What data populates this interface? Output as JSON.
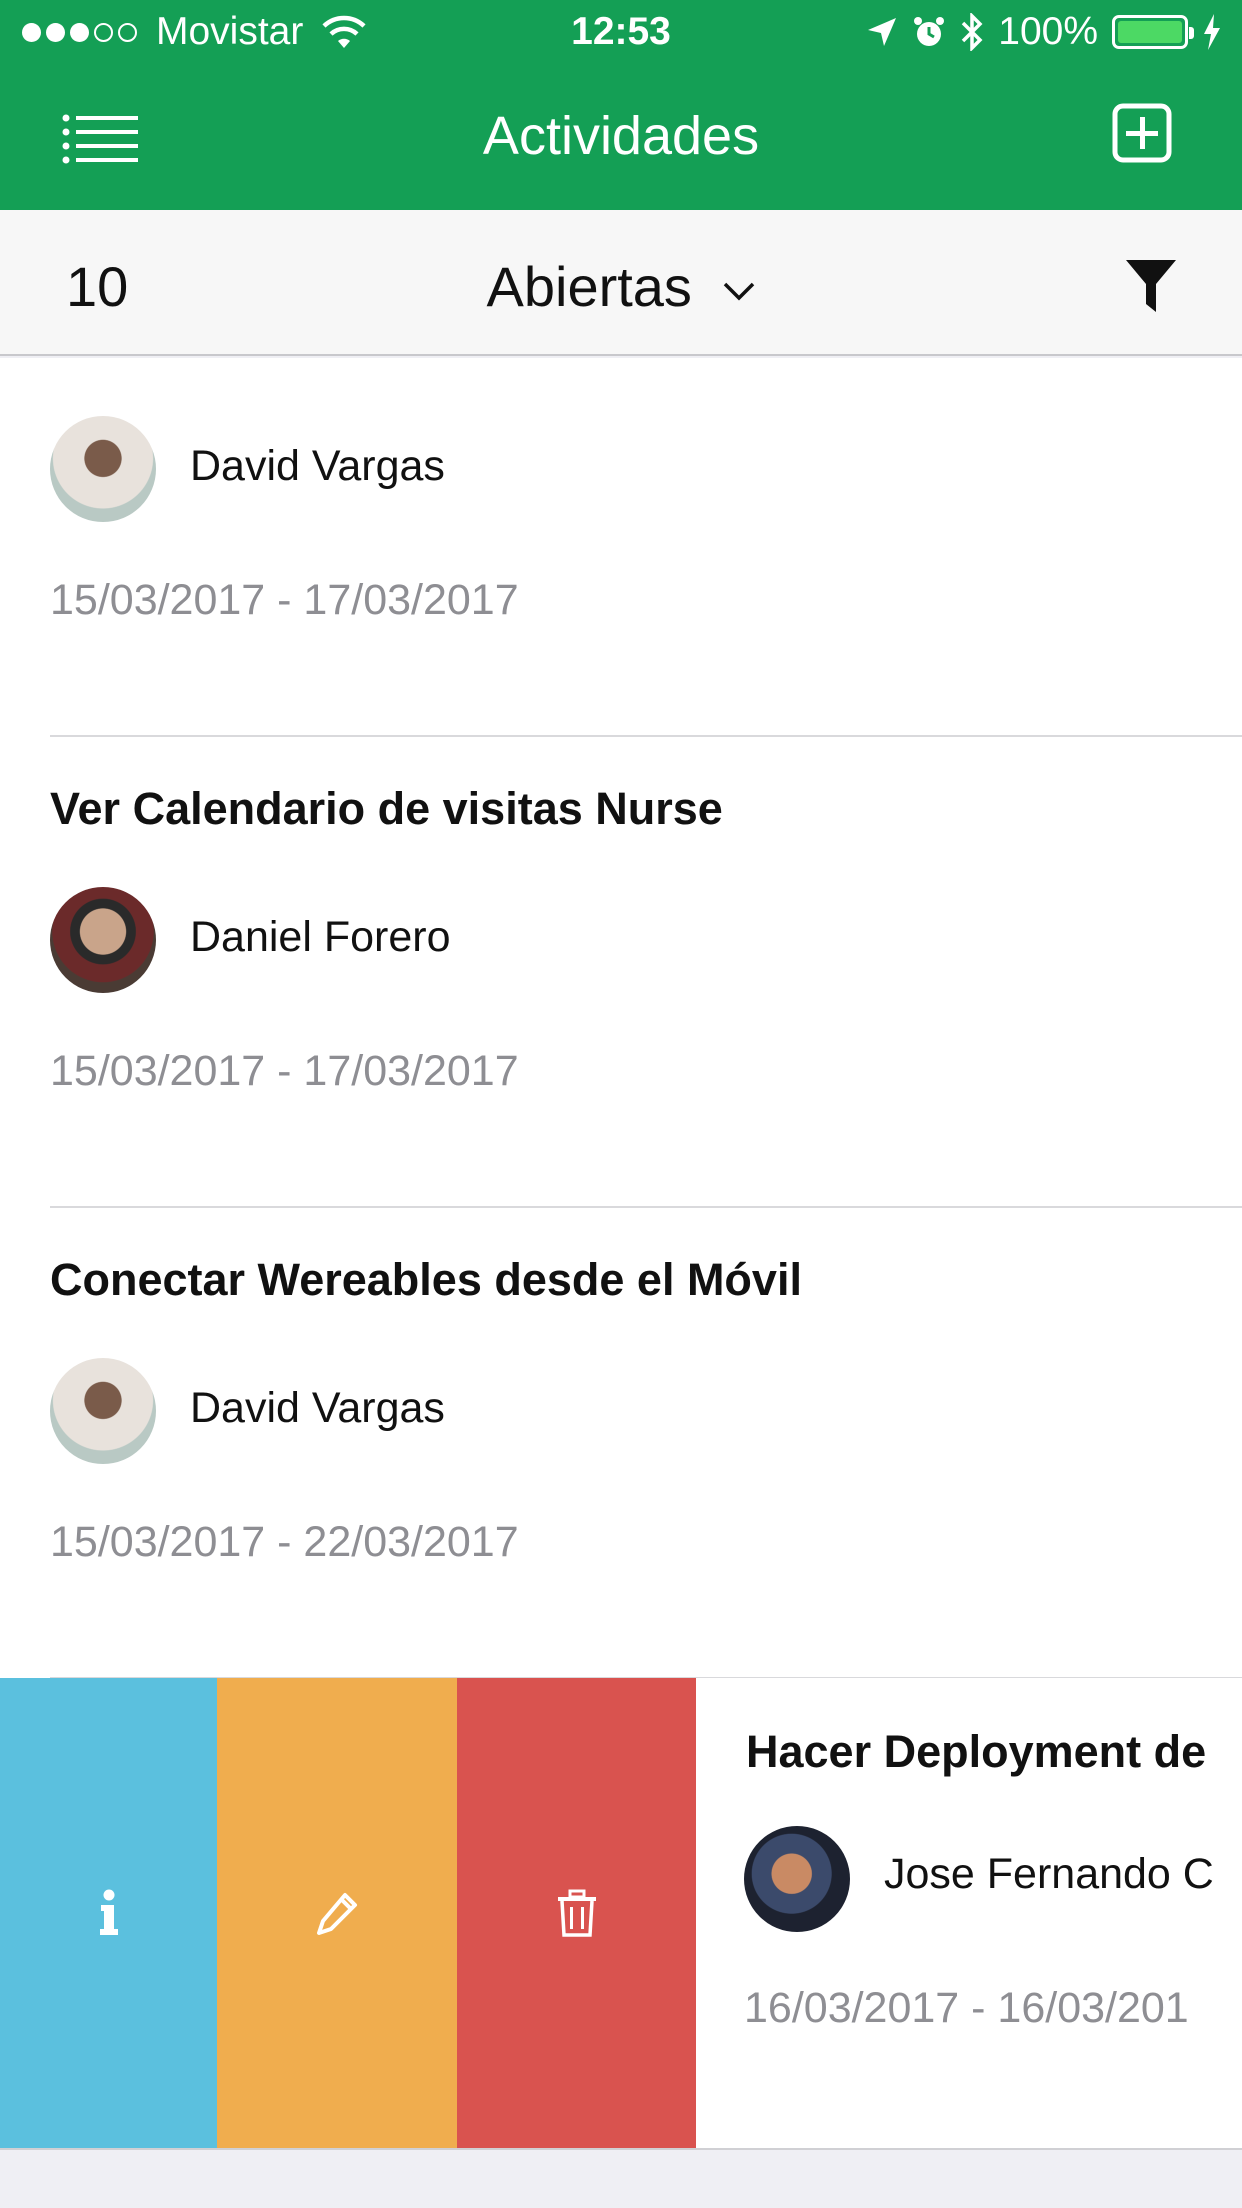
{
  "status_bar": {
    "carrier": "Movistar",
    "time": "12:53",
    "battery": "100%",
    "signal_bars": 3,
    "signal_total": 5
  },
  "nav": {
    "title": "Actividades",
    "menu_icon": "list-menu-icon",
    "add_icon": "plus-square-icon"
  },
  "filter": {
    "count": "10",
    "state": "Abiertas",
    "filter_icon": "funnel-icon"
  },
  "activities": [
    {
      "title": "",
      "person": "David Vargas",
      "dates": "15/03/2017 - 17/03/2017",
      "avatar_color": "#b9c9c4"
    },
    {
      "title": "Ver Calendario de visitas Nurse",
      "person": "Daniel Forero",
      "dates": "15/03/2017 - 17/03/2017",
      "avatar_color": "#5a3d33"
    },
    {
      "title": "Conectar Wereables desde el Móvil",
      "person": "David Vargas",
      "dates": "15/03/2017 - 22/03/2017",
      "avatar_color": "#b9c9c4"
    },
    {
      "title": "Hacer Deployment de",
      "person": "Jose Fernando C",
      "dates": "16/03/2017 - 16/03/201",
      "avatar_color": "#2a2f3a"
    }
  ],
  "swipe_actions": {
    "info_color": "#5bc0de",
    "edit_color": "#f0ad4e",
    "delete_color": "#d9534f",
    "info_icon": "info-icon",
    "edit_icon": "pencil-icon",
    "delete_icon": "trash-icon"
  },
  "colors": {
    "brand": "#149f55",
    "date_text": "#8e8e93"
  }
}
